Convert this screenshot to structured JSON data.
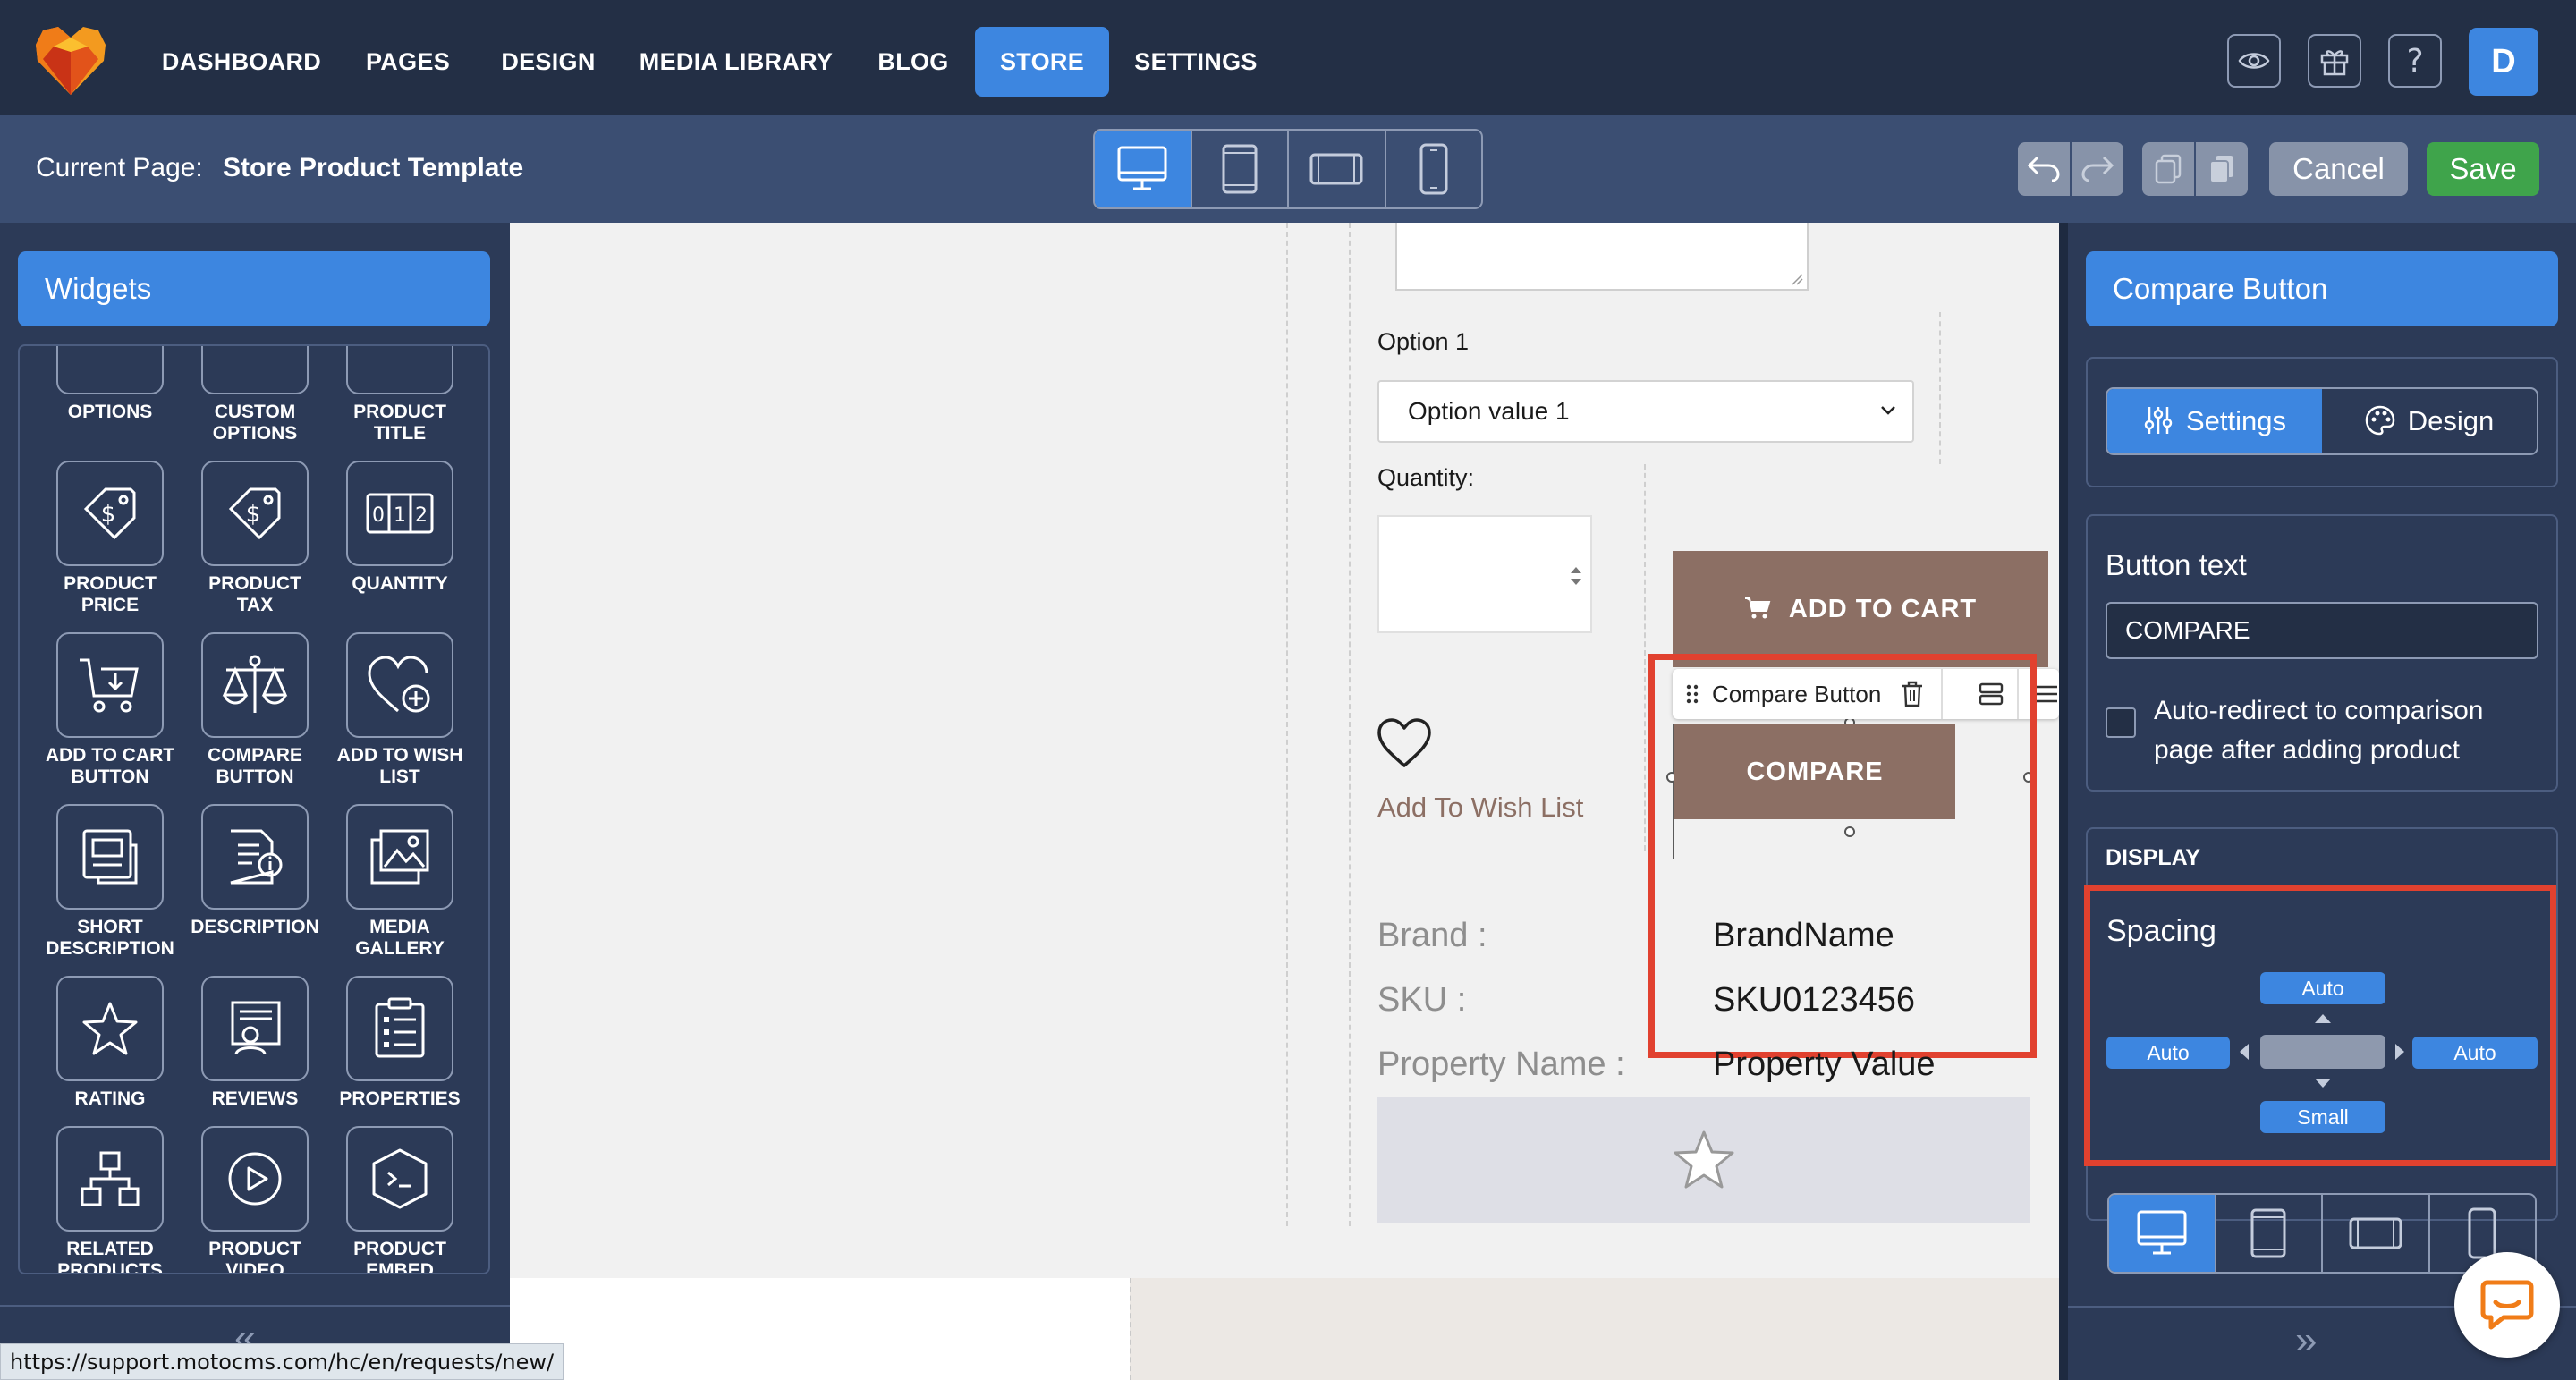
{
  "nav": {
    "items": [
      {
        "label": "DASHBOARD"
      },
      {
        "label": "PAGES"
      },
      {
        "label": "DESIGN"
      },
      {
        "label": "MEDIA LIBRARY"
      },
      {
        "label": "BLOG"
      },
      {
        "label": "STORE",
        "active": true
      },
      {
        "label": "SETTINGS"
      }
    ],
    "icons": [
      "eye-icon",
      "gift-icon",
      "help-icon"
    ],
    "avatar": "D"
  },
  "subbar": {
    "current_label": "Current Page:",
    "current_page": "Store Product Template",
    "devices": [
      "desktop-icon",
      "tablet-icon",
      "tablet-landscape-icon",
      "phone-icon"
    ],
    "cancel": "Cancel",
    "save": "Save"
  },
  "widgets": {
    "title": "Widgets",
    "items": [
      {
        "label": "OPTIONS",
        "icon": "options-icon"
      },
      {
        "label": "CUSTOM OPTIONS",
        "icon": "custom-options-icon"
      },
      {
        "label": "PRODUCT TITLE",
        "icon": "product-title-icon"
      },
      {
        "label": "PRODUCT PRICE",
        "icon": "price-tag-icon"
      },
      {
        "label": "PRODUCT TAX",
        "icon": "tax-tag-icon"
      },
      {
        "label": "QUANTITY",
        "icon": "quantity-icon"
      },
      {
        "label": "ADD TO CART BUTTON",
        "icon": "cart-icon"
      },
      {
        "label": "COMPARE BUTTON",
        "icon": "scales-icon"
      },
      {
        "label": "ADD TO WISH LIST",
        "icon": "heart-plus-icon"
      },
      {
        "label": "SHORT DESCRIPTION",
        "icon": "short-description-icon"
      },
      {
        "label": "DESCRIPTION",
        "icon": "description-icon"
      },
      {
        "label": "MEDIA GALLERY",
        "icon": "media-gallery-icon"
      },
      {
        "label": "RATING",
        "icon": "star-icon"
      },
      {
        "label": "REVIEWS",
        "icon": "reviews-icon"
      },
      {
        "label": "PROPERTIES",
        "icon": "properties-icon"
      },
      {
        "label": "RELATED PRODUCTS",
        "icon": "related-products-icon"
      },
      {
        "label": "PRODUCT VIDEO",
        "icon": "video-icon"
      },
      {
        "label": "PRODUCT EMBED",
        "icon": "embed-icon"
      }
    ],
    "collapse": "«"
  },
  "status_url": "https://support.motocms.com/hc/en/requests/new/",
  "canvas": {
    "option_label": "Option 1",
    "option_value": "Option value 1",
    "quantity_label": "Quantity:",
    "add_to_cart": "ADD TO CART",
    "wishlist": "Add To Wish List",
    "toolbar_label": "Compare Button",
    "compare": "COMPARE",
    "meta": [
      {
        "label": "Brand :",
        "value": "BrandName"
      },
      {
        "label": "SKU :",
        "value": "SKU0123456"
      },
      {
        "label": "Property Name :",
        "value": "Property Value"
      }
    ],
    "brand_color": "#8c6f64",
    "selection_color": "#e1412f"
  },
  "right": {
    "title": "Compare Button",
    "tabs": [
      {
        "label": "Settings",
        "icon": "sliders-icon",
        "active": true
      },
      {
        "label": "Design",
        "icon": "palette-icon"
      }
    ],
    "button_text_label": "Button text",
    "button_text_value": "COMPARE",
    "redirect_label": "Auto-redirect to comparison page after adding product",
    "display_label": "DISPLAY",
    "spacing": {
      "title": "Spacing",
      "top": "Auto",
      "left": "Auto",
      "right": "Auto",
      "bottom": "Small"
    },
    "collapse": "»",
    "accent": "#3d86e0"
  }
}
